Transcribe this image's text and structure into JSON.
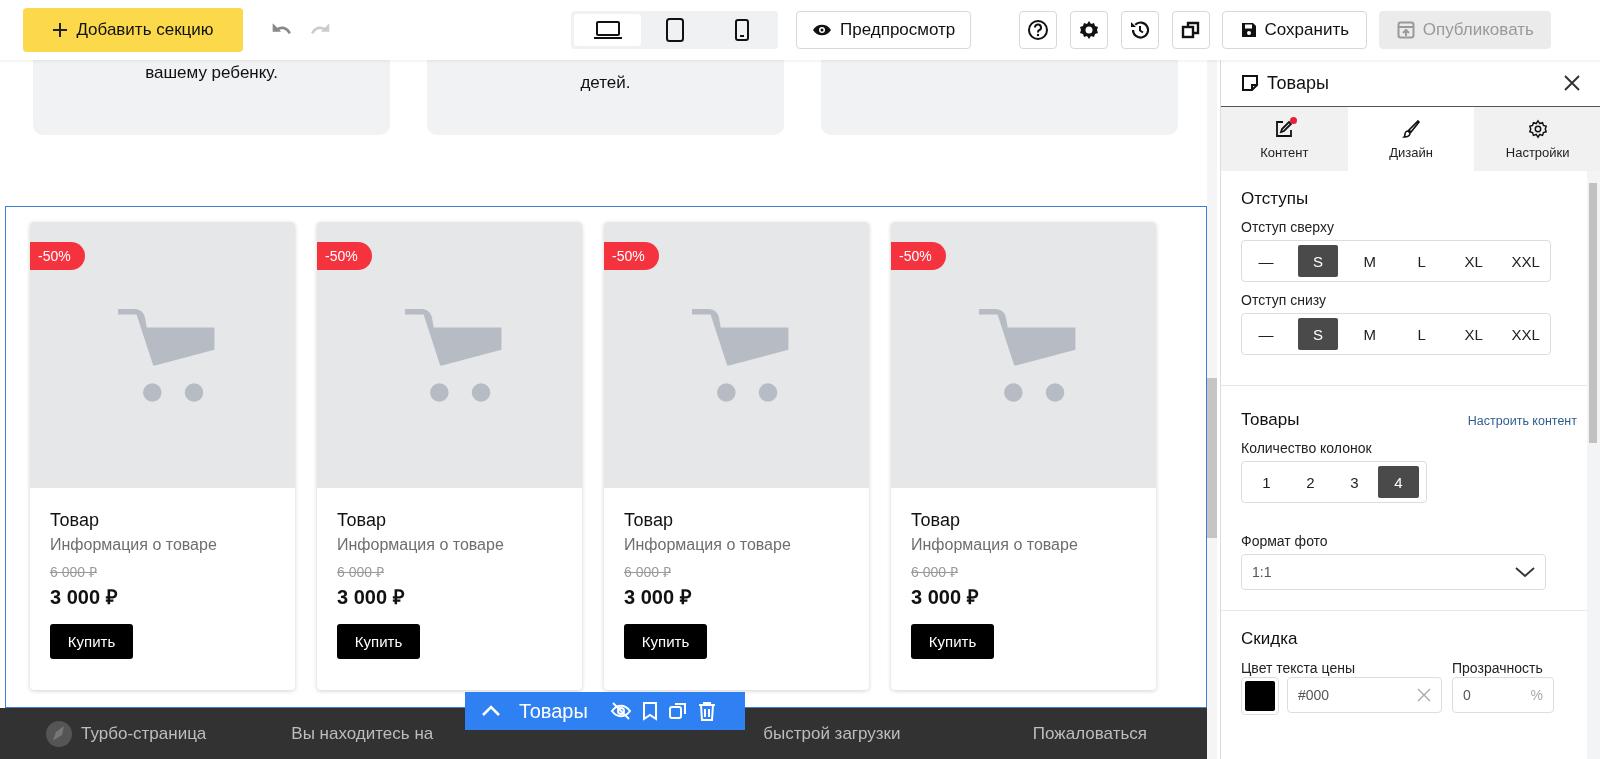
{
  "toolbar": {
    "add_section": "Добавить секцию",
    "history": [
      {
        "kind": "undo",
        "disabled": false
      },
      {
        "kind": "redo",
        "disabled": true
      }
    ],
    "devices": [
      {
        "kind": "desktop",
        "selected": true
      },
      {
        "kind": "tablet",
        "selected": false
      },
      {
        "kind": "phone",
        "selected": false
      }
    ],
    "preview": "Предпросмотр",
    "tools": [
      {
        "kind": "help"
      },
      {
        "kind": "settings"
      },
      {
        "kind": "history"
      },
      {
        "kind": "copy"
      }
    ],
    "save": "Сохранить",
    "publish": {
      "label": "Опубликовать",
      "disabled": true
    }
  },
  "top_cards": [
    {
      "kind": "text",
      "text": "вашему ребенку."
    },
    {
      "kind": "text",
      "text": "детей."
    },
    {
      "kind": "empty"
    }
  ],
  "products": [
    {
      "badge": "-50%",
      "title": "Товар",
      "info": "Информация о товаре",
      "old_price": "6 000 ₽",
      "price": "3 000 ₽",
      "button": "Купить"
    },
    {
      "badge": "-50%",
      "title": "Товар",
      "info": "Информация о товаре",
      "old_price": "6 000 ₽",
      "price": "3 000 ₽",
      "button": "Купить"
    },
    {
      "badge": "-50%",
      "title": "Товар",
      "info": "Информация о товаре",
      "old_price": "6 000 ₽",
      "price": "3 000 ₽",
      "button": "Купить"
    },
    {
      "badge": "-50%",
      "title": "Товар",
      "info": "Информация о товаре",
      "old_price": "6 000 ₽",
      "price": "3 000 ₽",
      "button": "Купить"
    }
  ],
  "section_toolbar": {
    "title": "Товары"
  },
  "footer": {
    "brand": "Турбо-страница",
    "notice_left": "Вы находитесь на",
    "notice_right": "быстрой загрузки",
    "report": "Пожаловаться"
  },
  "panel": {
    "title": "Товары",
    "tabs": [
      {
        "kind": "content",
        "label": "Контент",
        "selected": false,
        "notification": true
      },
      {
        "kind": "design",
        "label": "Дизайн",
        "selected": true,
        "notification": false
      },
      {
        "kind": "settings",
        "label": "Настройки",
        "selected": false,
        "notification": false
      }
    ],
    "padding": {
      "title": "Отступы",
      "groups": [
        {
          "label": "Отступ сверху",
          "options": [
            {
              "label": "—",
              "selected": false
            },
            {
              "label": "S",
              "selected": true
            },
            {
              "label": "M",
              "selected": false
            },
            {
              "label": "L",
              "selected": false
            },
            {
              "label": "XL",
              "selected": false
            },
            {
              "label": "XXL",
              "selected": false
            }
          ]
        },
        {
          "label": "Отступ снизу",
          "options": [
            {
              "label": "—",
              "selected": false
            },
            {
              "label": "S",
              "selected": true
            },
            {
              "label": "M",
              "selected": false
            },
            {
              "label": "L",
              "selected": false
            },
            {
              "label": "XL",
              "selected": false
            },
            {
              "label": "XXL",
              "selected": false
            }
          ]
        }
      ]
    },
    "goods": {
      "title": "Товары",
      "link": "Настроить контент",
      "columns": {
        "label": "Количество колонок",
        "options": [
          {
            "label": "1",
            "selected": false
          },
          {
            "label": "2",
            "selected": false
          },
          {
            "label": "3",
            "selected": false
          },
          {
            "label": "4",
            "selected": true
          }
        ]
      },
      "photo_format": {
        "label": "Формат фото",
        "value": "1:1"
      }
    },
    "discount": {
      "title": "Скидка",
      "price_color": {
        "label": "Цвет текста цены",
        "color": "#000000",
        "value": "#000"
      },
      "opacity": {
        "label": "Прозрачность",
        "value": "0",
        "unit": "%"
      }
    }
  }
}
